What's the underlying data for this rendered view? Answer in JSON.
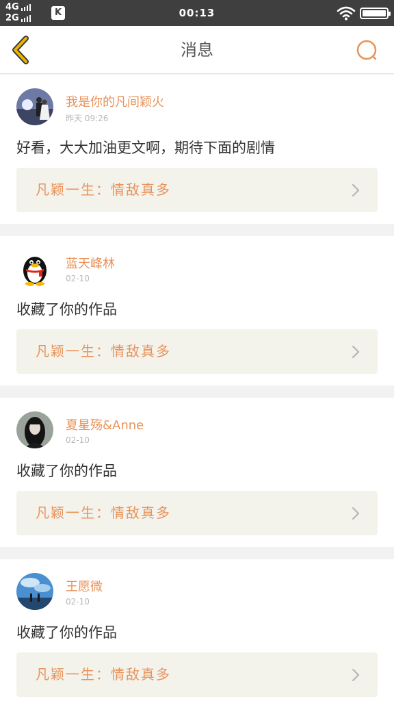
{
  "status_bar": {
    "network_top": "4G",
    "network_bottom": "2G",
    "app_badge": "K",
    "time": "00:13"
  },
  "header": {
    "title": "消息"
  },
  "colors": {
    "accent": "#e8935a",
    "back_icon": "#f0b400",
    "link_bg": "#f3f3ec"
  },
  "messages": [
    {
      "username": "我是你的凡间颖火",
      "time": "昨天 09:26",
      "text": "好看，大大加油更文啊，期待下面的剧情",
      "work_title": "凡颖一生：情敌真多",
      "avatar": "wedding-photo-avatar"
    },
    {
      "username": "蓝天峰林",
      "time": "02-10",
      "text": "收藏了你的作品",
      "work_title": "凡颖一生：情敌真多",
      "avatar": "qq-penguin-avatar"
    },
    {
      "username": "夏星殇&Anne",
      "time": "02-10",
      "text": "收藏了你的作品",
      "work_title": "凡颖一生：情敌真多",
      "avatar": "girl-portrait-avatar"
    },
    {
      "username": "王愿微",
      "time": "02-10",
      "text": "收藏了你的作品",
      "work_title": "凡颖一生：情敌真多",
      "avatar": "anime-sky-avatar"
    }
  ]
}
